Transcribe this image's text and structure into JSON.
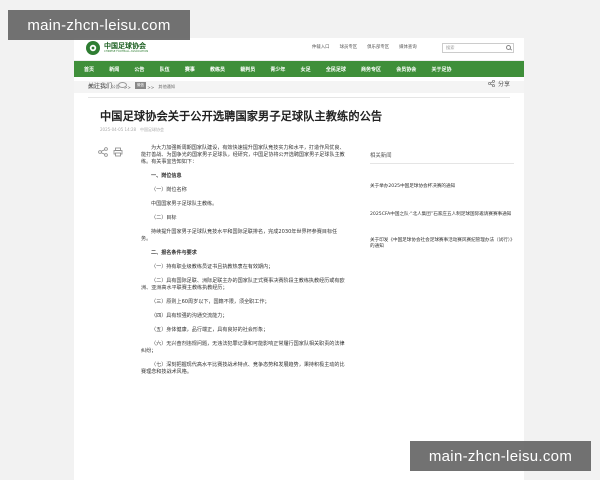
{
  "watermark": "main-zhcn-leisu.com",
  "header": {
    "logo_cn": "中国足球协会",
    "logo_en": "CHINESE FOOTBALL ASSOCIATION",
    "top_links": [
      "仲裁入口",
      "球员专区",
      "俱乐部专区",
      "媒体查询"
    ],
    "search_placeholder": "搜索"
  },
  "nav": [
    "首页",
    "新闻",
    "公告",
    "队伍",
    "赛事",
    "教练员",
    "裁判员",
    "青少年",
    "女足",
    "全民足球",
    "商务专区",
    "会员协会",
    "关于足协"
  ],
  "breadcrumb": [
    "首页",
    ">>",
    "公告",
    ">>",
    "应试",
    ">>",
    "其他通知"
  ],
  "share": {
    "follow_label": "关注我们",
    "wechat_label": "微信",
    "share_label": "分享"
  },
  "article": {
    "title": "中国足球协会关于公开选聘国家男子足球队主教练的公告",
    "meta": "2025-04-05 14:28　中国足球协会",
    "intro": "为大力加强新周期国家队建设，有效快速提升国家队竞技实力和水平，打造作风优良、能打善战、为国争光的国家男子足球队，经研究，中国足协将公开选聘国家男子足球队主教练。有关事宜告知如下：",
    "s1": "一、岗位信息",
    "s1a": "（一）岗位名称",
    "s1a_text": "中国国家男子足球队主教练。",
    "s1b": "（二）目标",
    "s1b_text": "持续提升国家男子足球队竞技水平和国际足联排名，完成2030年世界杯参赛目标任务。",
    "s2": "二、报名条件与要求",
    "req": [
      "（一）持有职业级教练员证书且执教热衷在有效期内；",
      "（二）具有国际足联、洲际足联主办的国家队正式赛事决赛阶段主教练执教经历或有欧洲、亚洲高水平联赛主教练执教经历；",
      "（三）原则上60周岁以下，国籍不限，须全职工作；",
      "（四）具有较强的沟通交流能力；",
      "（五）身体健康，品行端正，具有良好的社会形象；",
      "（六）无兴奋剂违规问题，无违法犯罪记录和可能影响正常履行国家队相关职责的法律纠纷；",
      "（七）深刻把握现代高水平比赛技战术特点、竞争态势和发展趋势，秉持积极主动的比赛理念和技战术风格。"
    ]
  },
  "related": {
    "title": "相关新闻",
    "items": [
      "关于举办2025中国足球协会杯决赛的通知",
      "2025CFA中国之队·“北人集团”石家庄五人制足球国际邀请赛赛事通知",
      "关于印发《中国足球协会社会足球赛事活动赛风赛纪管理办法（试行）》的通知"
    ]
  }
}
